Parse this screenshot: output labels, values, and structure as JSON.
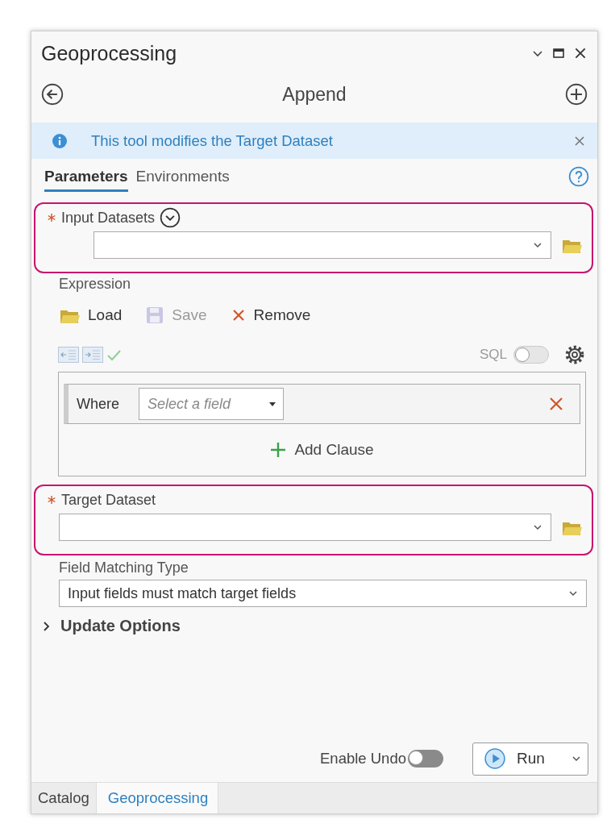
{
  "window": {
    "title": "Geoprocessing"
  },
  "tool": {
    "title": "Append"
  },
  "info_banner": {
    "text": "This tool modifies the Target Dataset"
  },
  "tabs": [
    {
      "label": "Parameters",
      "selected": true
    },
    {
      "label": "Environments",
      "selected": false
    }
  ],
  "parameters": [
    {
      "kind": "dataset",
      "label": "Input Datasets",
      "required": true,
      "highlighted": true,
      "list": true
    },
    {
      "kind": "expression",
      "label": "Expression",
      "actions": [
        {
          "kind": "load",
          "label": "Load",
          "disabled": false
        },
        {
          "kind": "save",
          "label": "Save",
          "disabled": true
        },
        {
          "kind": "remove",
          "label": "Remove",
          "disabled": false
        }
      ],
      "sql_toggle": {
        "label": "SQL",
        "on": false
      },
      "clauses": [
        {
          "keyword": "Where",
          "placeholder": "Select a field"
        }
      ],
      "add_label": "Add Clause"
    },
    {
      "kind": "dataset",
      "label": "Target Dataset",
      "required": true,
      "highlighted": true,
      "list": false
    },
    {
      "kind": "select",
      "label": "Field Matching Type",
      "value": "Input fields must match target fields"
    },
    {
      "kind": "group",
      "label": "Update Options",
      "expanded": false
    }
  ],
  "footer": {
    "undo": {
      "label": "Enable Undo",
      "on": false
    },
    "run": {
      "label": "Run"
    }
  },
  "bottom_tabs": [
    {
      "label": "Catalog",
      "selected": false
    },
    {
      "label": "Geoprocessing",
      "selected": true
    }
  ]
}
